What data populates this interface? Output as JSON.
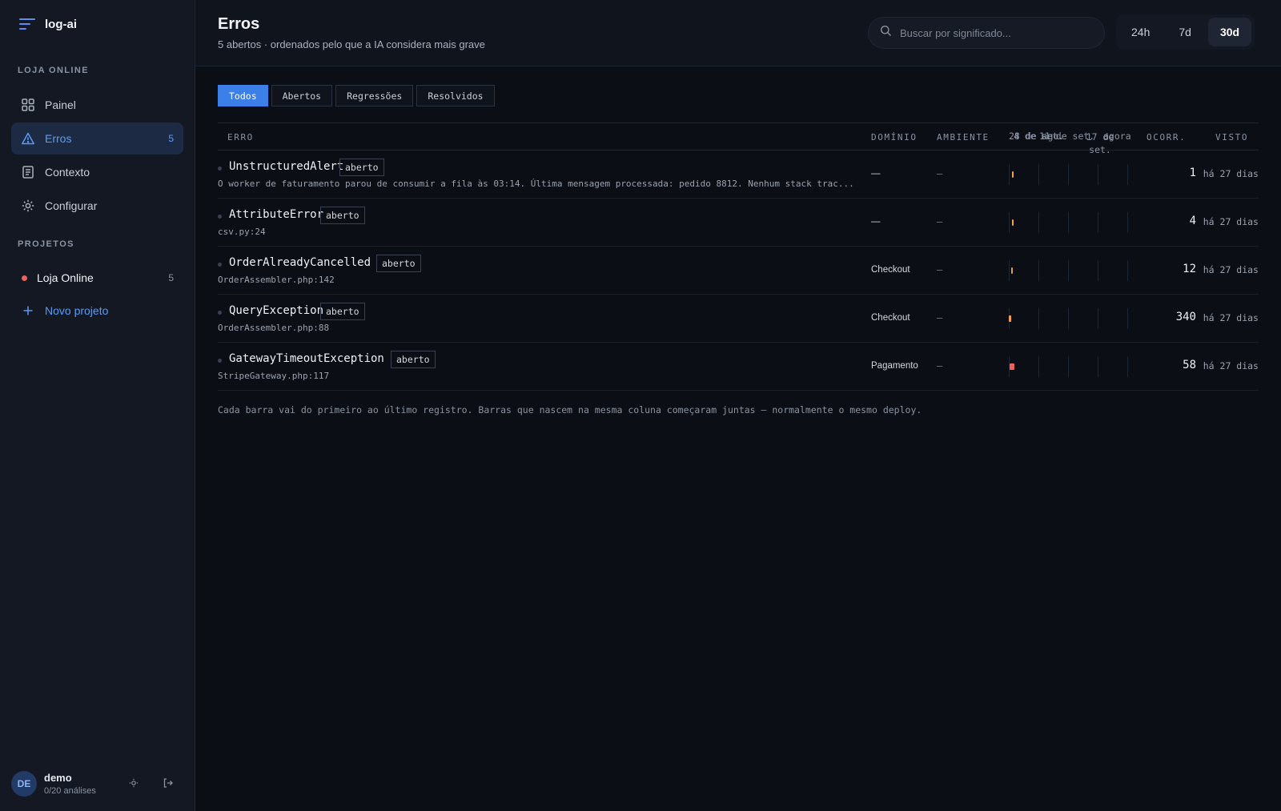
{
  "app": {
    "name": "log-ai"
  },
  "sidebar": {
    "section_store": "LOJA ONLINE",
    "nav": [
      {
        "label": "Painel",
        "icon": "grid-icon"
      },
      {
        "label": "Erros",
        "icon": "warning-icon",
        "count": "5"
      },
      {
        "label": "Contexto",
        "icon": "document-icon"
      },
      {
        "label": "Configurar",
        "icon": "gear-icon"
      }
    ],
    "section_projects": "PROJETOS",
    "project": {
      "label": "Loja Online",
      "count": "5",
      "status_color": "#f0605a"
    },
    "new_project": "Novo projeto",
    "user": {
      "initials": "DE",
      "name": "demo",
      "usage": "0/20 análises"
    }
  },
  "header": {
    "title": "Erros",
    "subtitle": "5 abertos · ordenados pelo que a IA considera mais grave",
    "search_placeholder": "Buscar por significado...",
    "ranges": [
      "24h",
      "7d",
      "30d"
    ],
    "active_range": "30d"
  },
  "tabs": [
    "Todos",
    "Abertos",
    "Regressões",
    "Resolvidos"
  ],
  "active_tab": "Todos",
  "table": {
    "columns": {
      "error": "ERRO",
      "domain": "DOMÍNIO",
      "env": "AMBIENTE",
      "occ": "OCORR.",
      "seen": "VISTO"
    },
    "timeline_labels": [
      "28 de ago.",
      "4 de set.",
      "11 de set.",
      "17 de set.",
      "agora"
    ],
    "rows": [
      {
        "name": "UnstructuredAlert",
        "status": "aberto",
        "detail": "O worker de faturamento parou de consumir a fila às 03:14. Última mensagem processada: pedido 8812. Nenhum stack trac...",
        "domain": "—",
        "env": "–",
        "count": "1",
        "seen": "há 27 dias",
        "bar_color": "#f5a04a"
      },
      {
        "name": "AttributeError",
        "status": "aberto",
        "detail": "csv.py:24",
        "domain": "—",
        "env": "–",
        "count": "4",
        "seen": "há 27 dias",
        "bar_color": "#f5a04a"
      },
      {
        "name": "OrderAlreadyCancelled",
        "status": "aberto",
        "detail": "OrderAssembler.php:142",
        "domain": "Checkout",
        "env": "–",
        "count": "12",
        "seen": "há 27 dias",
        "bar_color": "#d9a24a"
      },
      {
        "name": "QueryException",
        "status": "aberto",
        "detail": "OrderAssembler.php:88",
        "domain": "Checkout",
        "env": "–",
        "count": "340",
        "seen": "há 27 dias",
        "bar_color": "#f5a04a"
      },
      {
        "name": "GatewayTimeoutException",
        "status": "aberto",
        "detail": "StripeGateway.php:117",
        "domain": "Pagamento",
        "env": "–",
        "count": "58",
        "seen": "há 27 dias",
        "bar_color": "#f0605a"
      }
    ]
  },
  "footnote": "Cada barra vai do primeiro ao último registro. Barras que nascem na mesma coluna começaram juntas — normalmente o mesmo deploy."
}
